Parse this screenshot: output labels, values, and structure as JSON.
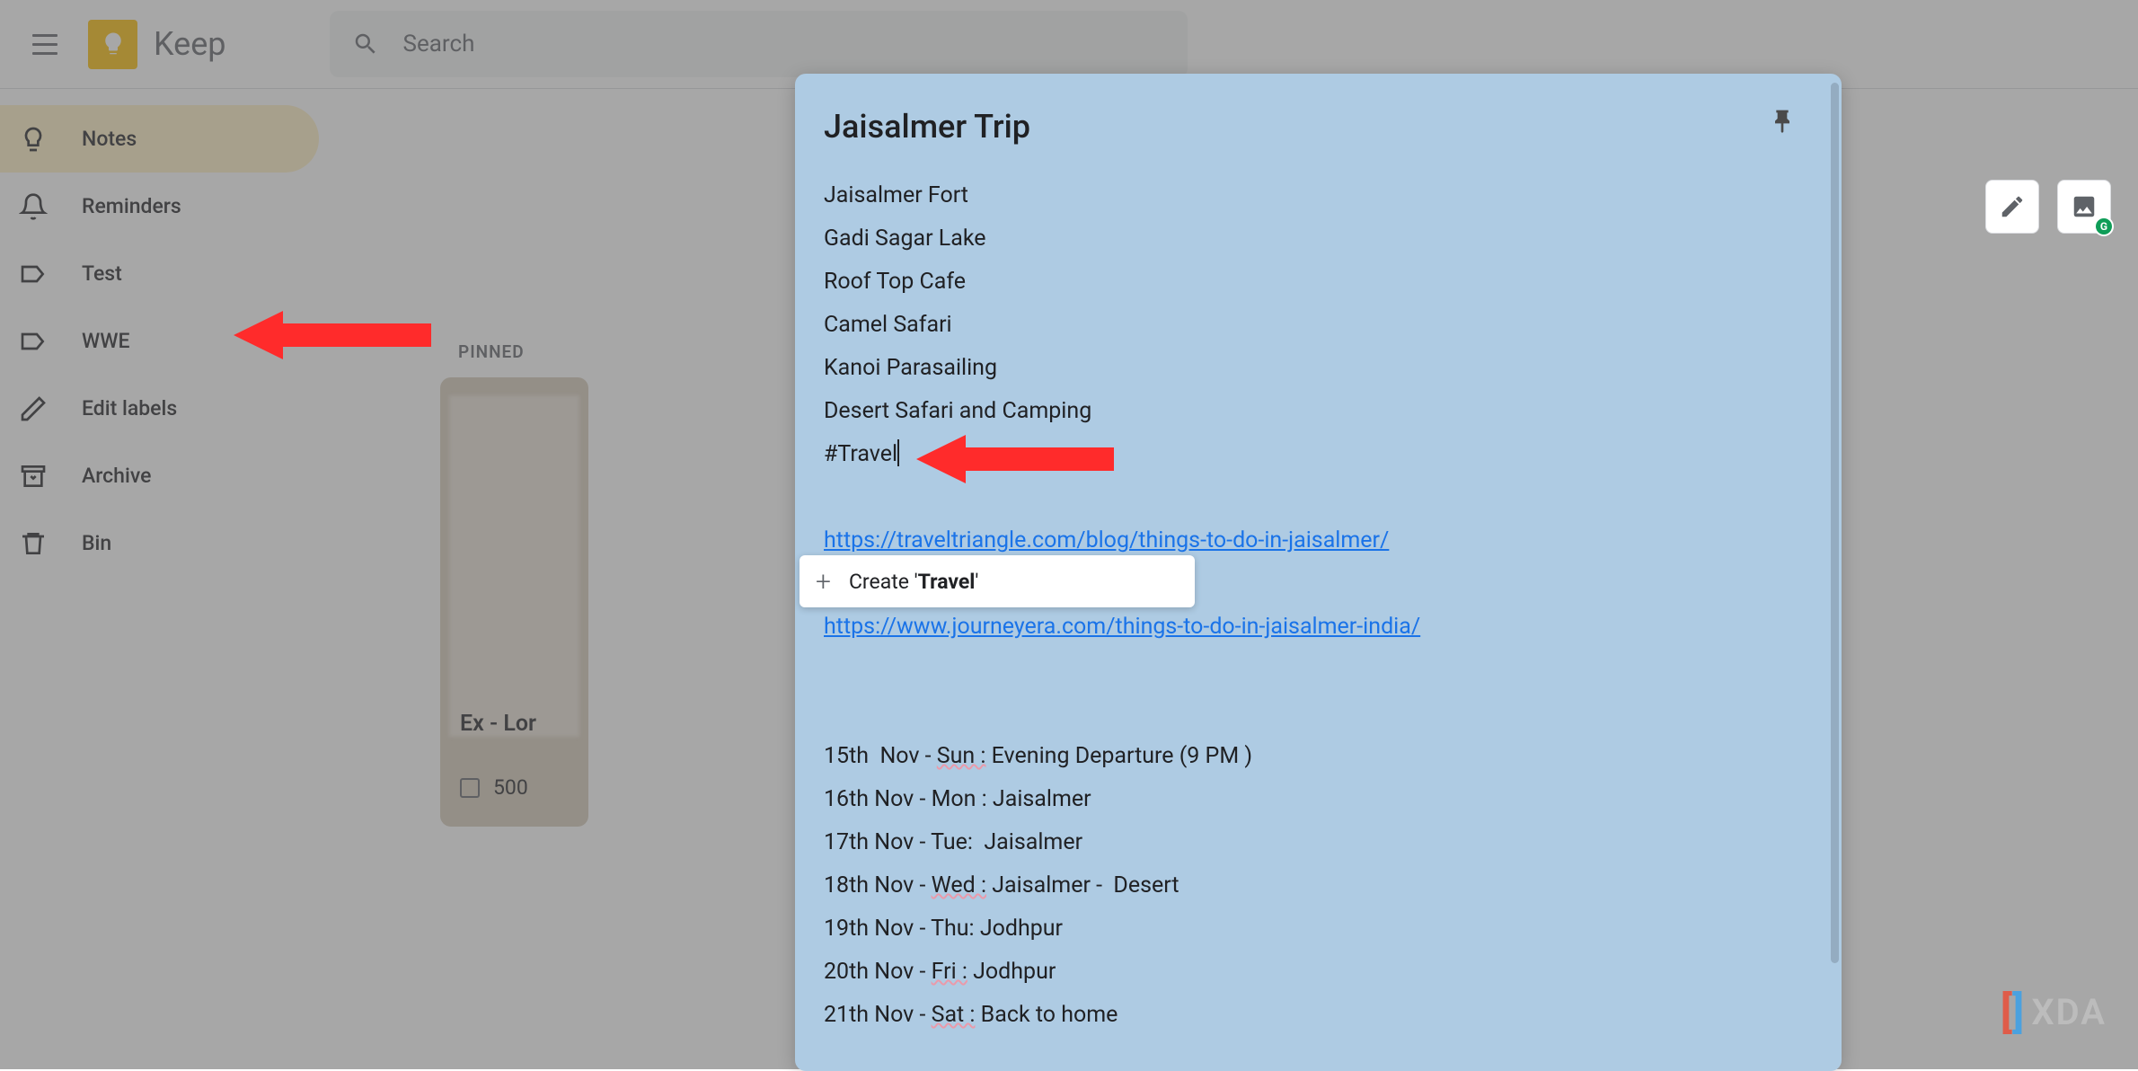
{
  "header": {
    "app_name": "Keep",
    "search_placeholder": "Search"
  },
  "sidebar": {
    "items": [
      {
        "label": "Notes",
        "icon": "lightbulb",
        "active": true
      },
      {
        "label": "Reminders",
        "icon": "bell",
        "active": false
      },
      {
        "label": "Test",
        "icon": "label",
        "active": false
      },
      {
        "label": "WWE",
        "icon": "label",
        "active": false
      },
      {
        "label": "Edit labels",
        "icon": "pencil",
        "active": false
      },
      {
        "label": "Archive",
        "icon": "archive",
        "active": false
      },
      {
        "label": "Bin",
        "icon": "trash",
        "active": false
      }
    ]
  },
  "pinned_label": "PINNED",
  "bg_card": {
    "title": "Ex - Lor",
    "value": "500"
  },
  "note": {
    "title": "Jaisalmer Trip",
    "lines": [
      "Jaisalmer Fort",
      "Gadi Sagar Lake",
      "Roof Top Cafe",
      "Camel Safari",
      "Kanoi Parasailing",
      "Desert Safari and Camping"
    ],
    "hashtag": "#Travel",
    "link1": "https://traveltriangle.com/blog/things-to-do-in-jaisalmer/",
    "link2": "https://www.journeyera.com/things-to-do-in-jaisalmer-india/",
    "schedule": [
      {
        "prefix": "15th  Nov - ",
        "wavy": "Sun :",
        "suffix": " Evening Departure (9 PM )"
      },
      {
        "prefix": "16th Nov - Mon : Jaisalmer",
        "wavy": "",
        "suffix": ""
      },
      {
        "prefix": "17th Nov - Tue:  Jaisalmer",
        "wavy": "",
        "suffix": ""
      },
      {
        "prefix": "18th Nov - ",
        "wavy": "Wed :",
        "suffix": " Jaisalmer -  Desert"
      },
      {
        "prefix": "19th Nov - Thu: Jodhpur",
        "wavy": "",
        "suffix": ""
      },
      {
        "prefix": "20th Nov - ",
        "wavy": "Fri :",
        "suffix": " Jodhpur"
      },
      {
        "prefix": "21th Nov - ",
        "wavy": "Sat :",
        "suffix": " Back to home"
      }
    ]
  },
  "create_label": {
    "prefix": "Create '",
    "bold": "Travel",
    "suffix": "'"
  },
  "watermark": "XDA"
}
